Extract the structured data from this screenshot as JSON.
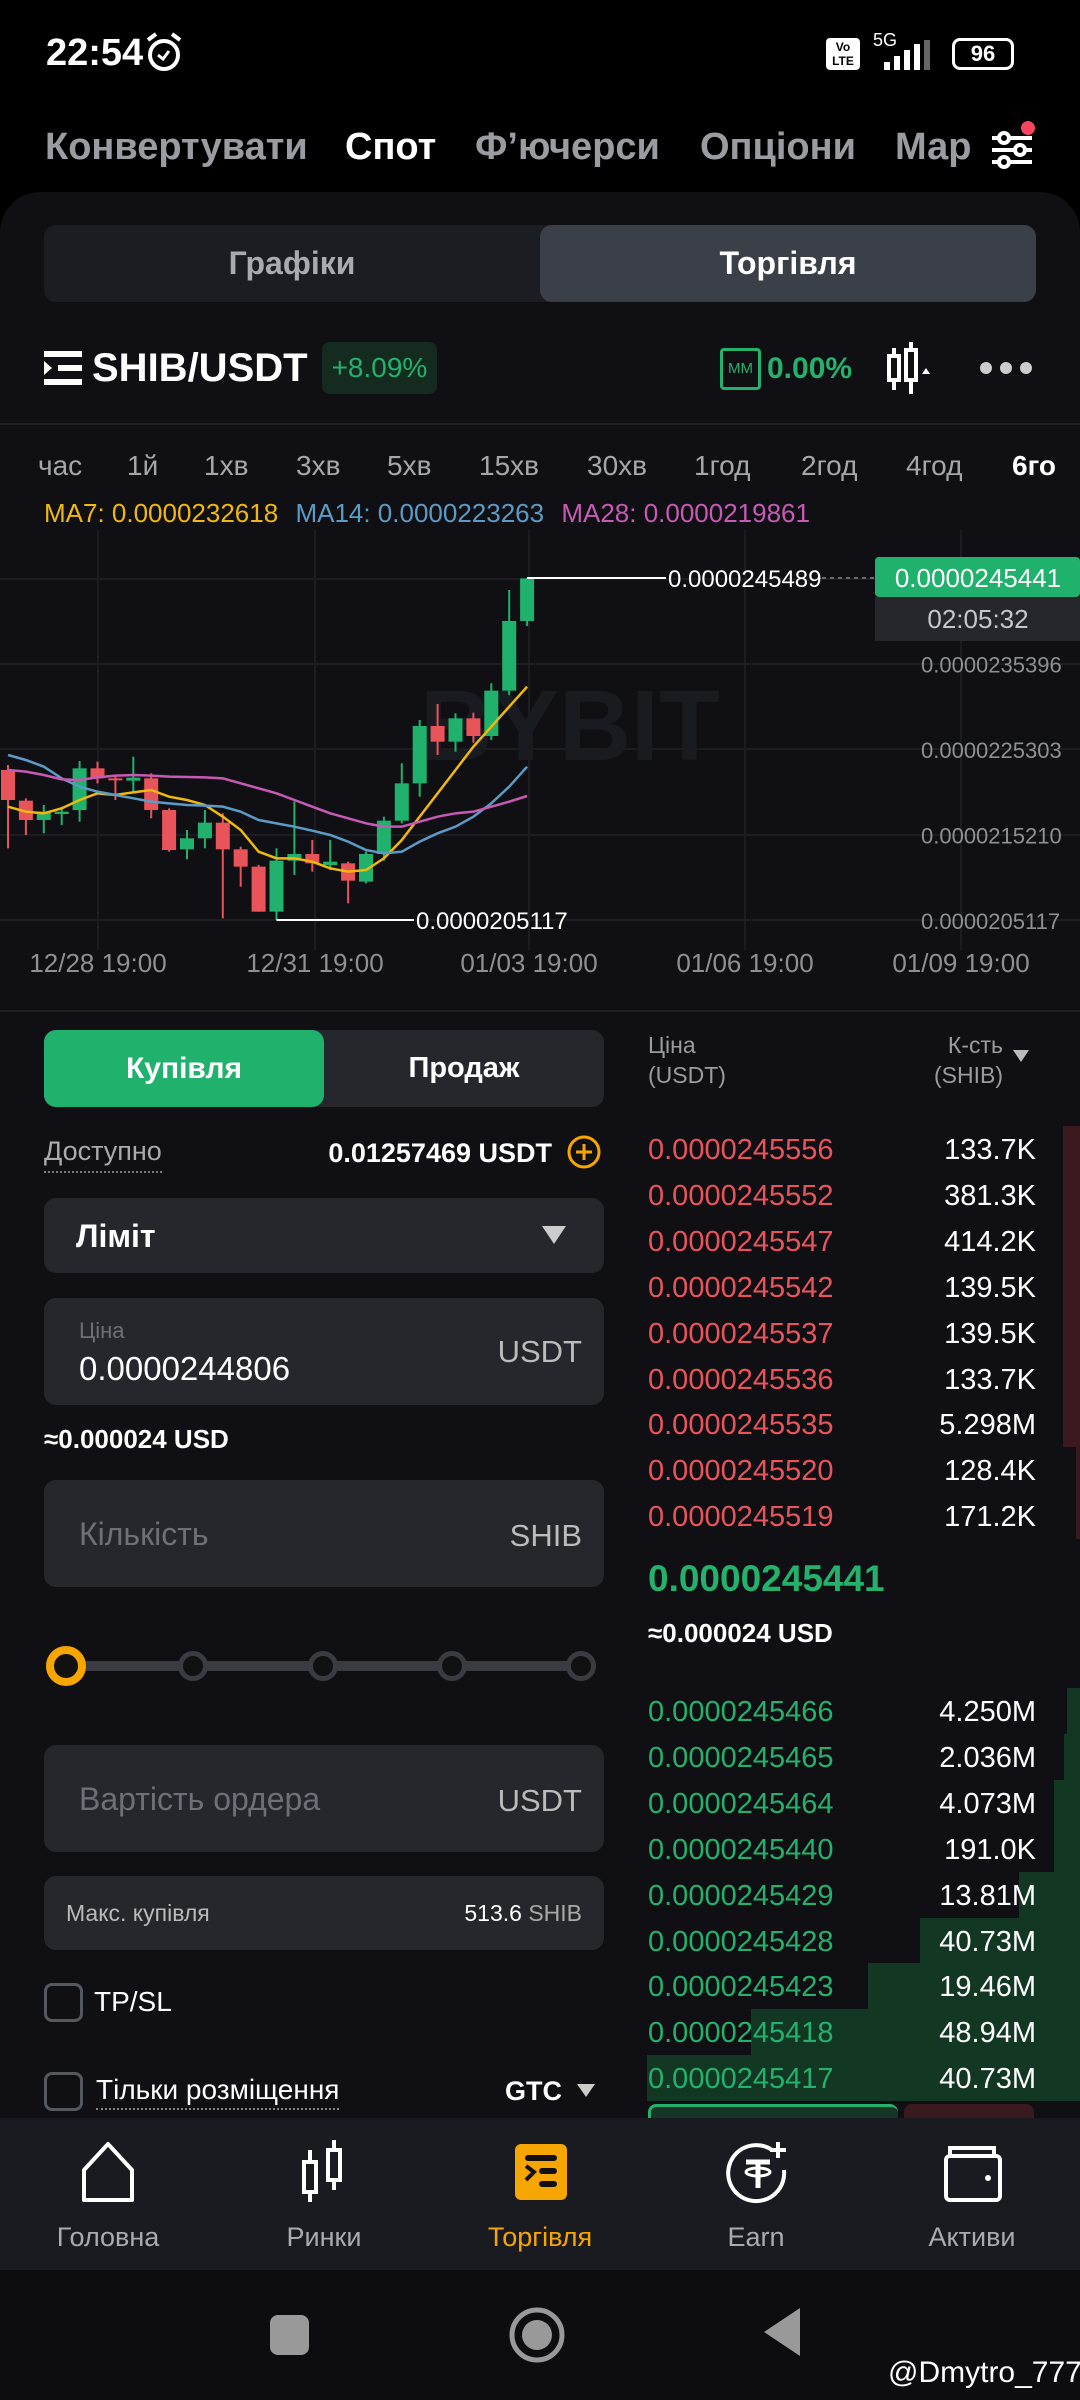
{
  "status_bar": {
    "time": "22:54",
    "network": "5G",
    "volte": "Vo LTE",
    "battery": "96"
  },
  "top_nav": {
    "items": [
      "Конвертувати",
      "Спот",
      "Ф’ючерси",
      "Опціони",
      "Мар"
    ],
    "active": "Спот"
  },
  "view_tabs": {
    "charts": "Графіки",
    "trade": "Торгівля",
    "active": "Торгівля"
  },
  "pair": {
    "symbol": "SHIB/USDT",
    "change": "+8.09%",
    "mm_label": "MM",
    "mm_value": "0.00%"
  },
  "timeframes": {
    "items": [
      "час",
      "1й",
      "1хв",
      "3хв",
      "5хв",
      "15хв",
      "30хв",
      "1год",
      "2год",
      "4год",
      "6го"
    ],
    "active": "6го"
  },
  "indicators": {
    "ma7": "MA7: 0.0000232618",
    "ma14": "MA14: 0.0000223263",
    "ma28": "MA28: 0.0000219861",
    "colors": {
      "ma7": "#f0b90b",
      "ma14": "#5b9bc6",
      "ma28": "#c75ab4"
    }
  },
  "chart_data": {
    "type": "candlestick",
    "price_unit_multiplier": 1e-10,
    "y_ticks": [
      "0.0000235396",
      "0.0000225303",
      "0.0000215210",
      "0.0000205117"
    ],
    "y_tick_values": [
      235396,
      225303,
      215210,
      205117
    ],
    "x_ticks": [
      "12/28 19:00",
      "12/31 19:00",
      "01/03 19:00",
      "01/06 19:00",
      "01/09 19:00"
    ],
    "high_label": "0.0000245489",
    "low_label": "0.0000205117",
    "last_price": "0.0000245441",
    "countdown": "02:05:32",
    "watermark": "BYBIT",
    "candles": [
      [
        222825,
        223415,
        213577,
        219283
      ],
      [
        219204,
        219480,
        215151,
        216922
      ],
      [
        216922,
        218693,
        215348,
        217906
      ],
      [
        217630,
        218496,
        216331,
        217906
      ],
      [
        218102,
        223888,
        216725,
        223022
      ],
      [
        223022,
        223809,
        221250,
        221840
      ],
      [
        221840,
        222234,
        219283,
        221644
      ],
      [
        221565,
        224399,
        220070,
        221919
      ],
      [
        221840,
        222431,
        217119,
        218102
      ],
      [
        218102,
        218299,
        213184,
        213381
      ],
      [
        213459,
        215741,
        212279,
        214758
      ],
      [
        214758,
        218102,
        213577,
        216607
      ],
      [
        216607,
        217709,
        205314,
        213459
      ],
      [
        213459,
        213774,
        209052,
        211413
      ],
      [
        211413,
        211609,
        206101,
        206101
      ],
      [
        206101,
        213577,
        205117,
        212121
      ],
      [
        212121,
        219086,
        210429,
        212908
      ],
      [
        212908,
        214561,
        210822,
        211806
      ],
      [
        211609,
        214561,
        211019,
        212003
      ],
      [
        211806,
        212003,
        207085,
        209760
      ],
      [
        209642,
        213184,
        209445,
        212908
      ],
      [
        212908,
        217315,
        212121,
        216843
      ],
      [
        216843,
        223612,
        216528,
        221250
      ],
      [
        221250,
        228727,
        219676,
        228018
      ],
      [
        228018,
        230616,
        224596,
        226169
      ],
      [
        226169,
        229514,
        224989,
        228924
      ],
      [
        228924,
        229593,
        226051,
        226838
      ],
      [
        226838,
        233055,
        226366,
        232190
      ],
      [
        232190,
        244074,
        231678,
        240414
      ],
      [
        240414,
        245489,
        239824,
        245441
      ]
    ],
    "ma7": [
      218496,
      217906,
      217709,
      218299,
      219283,
      220070,
      219873,
      220188,
      220464,
      219676,
      219283,
      218693,
      217315,
      215741,
      213184,
      212397,
      212397,
      212003,
      211216,
      210822,
      211019,
      212397,
      214561,
      217315,
      220070,
      222825,
      225579,
      227940,
      230301,
      232662
    ],
    "ma14": [
      224596,
      224005,
      223218,
      221840,
      220857,
      220267,
      219873,
      219480,
      219086,
      218889,
      218693,
      218614,
      218496,
      217906,
      216922,
      216528,
      216135,
      215663,
      215151,
      214364,
      213381,
      212987,
      213184,
      214364,
      215348,
      216135,
      217315,
      218889,
      220857,
      223218
    ],
    "ma28": [
      222825,
      222628,
      222234,
      221723,
      221644,
      221959,
      222156,
      222234,
      222156,
      222037,
      221998,
      221959,
      221840,
      221250,
      220660,
      220070,
      219283,
      218496,
      217709,
      217119,
      216528,
      216135,
      216135,
      216725,
      217315,
      217709,
      217906,
      218496,
      219086,
      219755
    ]
  },
  "order_form": {
    "buy": "Купівля",
    "sell": "Продаж",
    "active": "Купівля",
    "available_label": "Доступно",
    "available_value": "0.01257469 USDT",
    "order_type": "Ліміт",
    "price_label": "Ціна",
    "price_value": "0.0000244806",
    "price_unit": "USDT",
    "price_usd": "≈0.000024 USD",
    "qty_placeholder": "Кількість",
    "qty_unit": "SHIB",
    "slider_percent": 0,
    "value_placeholder": "Вартість ордера",
    "value_unit": "USDT",
    "max_buy_label": "Макс. купівля",
    "max_buy_value": "513.6",
    "max_buy_unit": "SHIB",
    "tpsl": "TP/SL",
    "post_only": "Тільки розміщення",
    "tif": "GTC"
  },
  "order_book": {
    "price_header": "Ціна",
    "price_header_unit": "(USDT)",
    "qty_header": "К-сть",
    "qty_header_unit": "(SHIB)",
    "asks": [
      {
        "price": "0.0000245556",
        "qty": "133.7K",
        "depth": 0.04
      },
      {
        "price": "0.0000245552",
        "qty": "381.3K",
        "depth": 0.04
      },
      {
        "price": "0.0000245547",
        "qty": "414.2K",
        "depth": 0.04
      },
      {
        "price": "0.0000245542",
        "qty": "139.5K",
        "depth": 0.04
      },
      {
        "price": "0.0000245537",
        "qty": "139.5K",
        "depth": 0.04
      },
      {
        "price": "0.0000245536",
        "qty": "133.7K",
        "depth": 0.04
      },
      {
        "price": "0.0000245535",
        "qty": "5.298M",
        "depth": 0.04
      },
      {
        "price": "0.0000245520",
        "qty": "128.4K",
        "depth": 0.01
      },
      {
        "price": "0.0000245519",
        "qty": "171.2K",
        "depth": 0.01
      }
    ],
    "mid_price": "0.0000245441",
    "mid_usd": "≈0.000024 USD",
    "bids": [
      {
        "price": "0.0000245466",
        "qty": "4.250M",
        "depth": 0.03
      },
      {
        "price": "0.0000245465",
        "qty": "2.036M",
        "depth": 0.037
      },
      {
        "price": "0.0000245464",
        "qty": "4.073M",
        "depth": 0.06
      },
      {
        "price": "0.0000245440",
        "qty": "191.0K",
        "depth": 0.06
      },
      {
        "price": "0.0000245429",
        "qty": "13.81M",
        "depth": 0.14
      },
      {
        "price": "0.0000245428",
        "qty": "40.73M",
        "depth": 0.37
      },
      {
        "price": "0.0000245423",
        "qty": "19.46M",
        "depth": 0.49
      },
      {
        "price": "0.0000245418",
        "qty": "48.94M",
        "depth": 0.76
      },
      {
        "price": "0.0000245417",
        "qty": "40.73M",
        "depth": 1.0
      }
    ]
  },
  "bottom_nav": {
    "items": [
      "Головна",
      "Ринки",
      "Торгівля",
      "Earn",
      "Активи"
    ],
    "active": "Торгівля"
  },
  "watermark": "@Dmytro_777",
  "colors": {
    "green": "#20b26c",
    "red": "#e8545a",
    "accent": "#f7a600"
  }
}
